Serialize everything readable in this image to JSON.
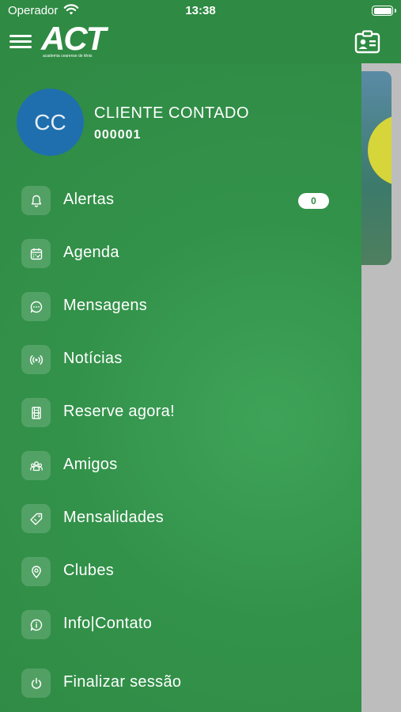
{
  "status_bar": {
    "carrier": "Operador",
    "time": "13:38"
  },
  "header": {
    "logo_text": "ACT",
    "logo_tagline": "academia cearense de tênis",
    "icons": {
      "menu": "hamburger-icon",
      "right": "contact-card-icon"
    }
  },
  "profile": {
    "initials": "CC",
    "name": "CLIENTE CONTADO",
    "id": "000001"
  },
  "menu": {
    "items": [
      {
        "label": "Alertas",
        "icon": "bell-icon",
        "badge": "0"
      },
      {
        "label": "Agenda",
        "icon": "calendar-icon"
      },
      {
        "label": "Mensagens",
        "icon": "chat-icon"
      },
      {
        "label": "Notícias",
        "icon": "broadcast-icon"
      },
      {
        "label": "Reserve agora!",
        "icon": "court-icon"
      },
      {
        "label": "Amigos",
        "icon": "friends-icon"
      },
      {
        "label": "Mensalidades",
        "icon": "tag-icon"
      },
      {
        "label": "Clubes",
        "icon": "location-icon"
      },
      {
        "label": "Info|Contato",
        "icon": "info-chat-icon"
      },
      {
        "label": "Finalizar sessão",
        "icon": "power-icon"
      }
    ]
  },
  "colors": {
    "header_green": "#2f8a43",
    "drawer_green": "#33924a",
    "avatar_blue": "#1f6fae",
    "backdrop_gray": "#bdbdbd"
  }
}
